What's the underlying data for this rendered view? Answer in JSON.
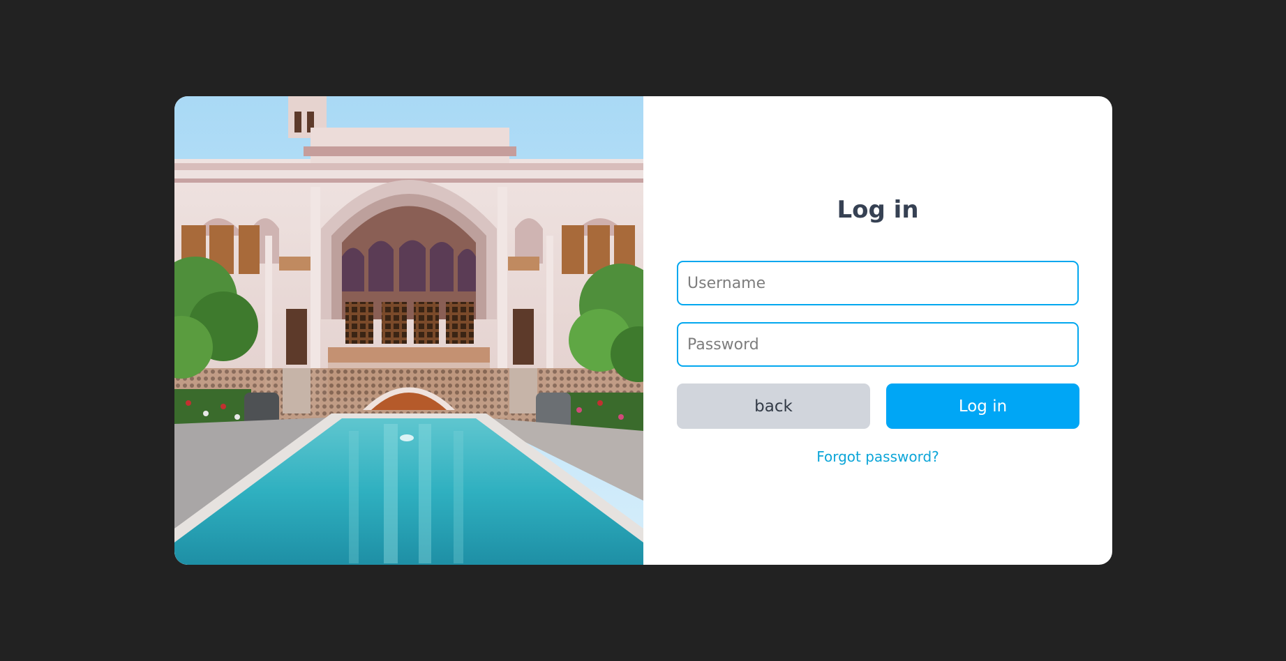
{
  "login": {
    "title": "Log in",
    "username_placeholder": "Username",
    "password_placeholder": "Password",
    "back_label": "back",
    "login_label": "Log in",
    "forgot_label": "Forgot password?"
  },
  "colors": {
    "page_background": "#222222",
    "card_background": "#ffffff",
    "accent": "#00a6f5",
    "field_border": "#02a7ef",
    "title_text": "#364153",
    "secondary_button": "#d1d5dc",
    "link": "#0ba5d8"
  }
}
